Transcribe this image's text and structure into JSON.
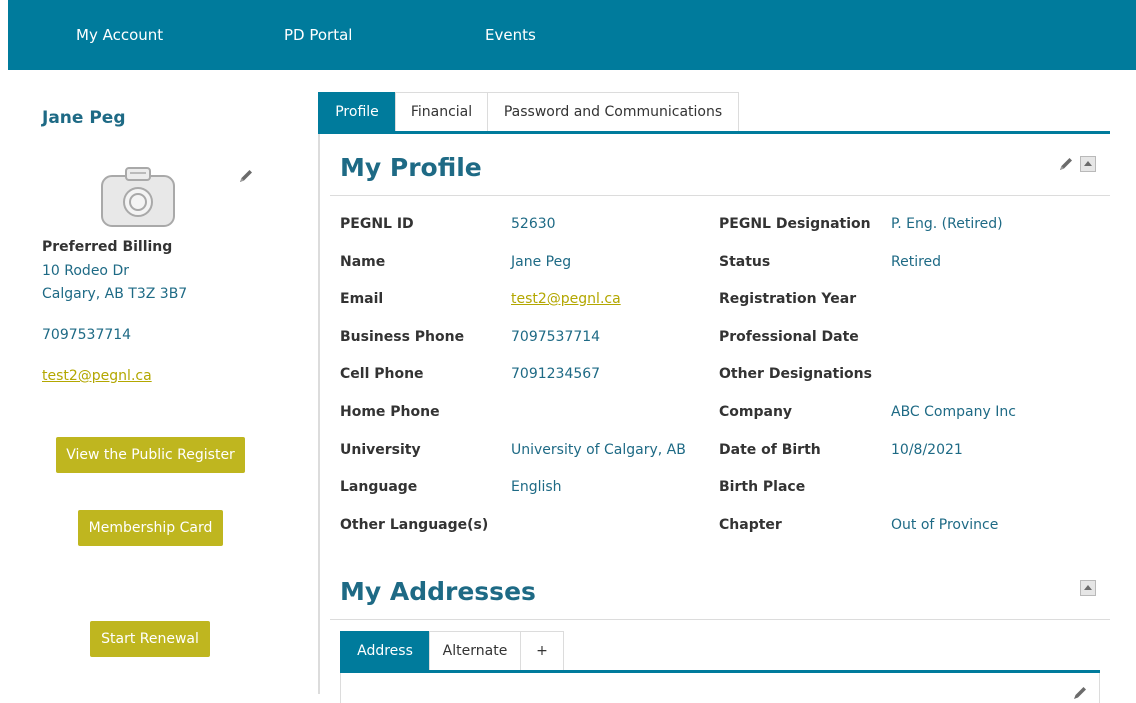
{
  "nav": {
    "items": [
      "My Account",
      "PD Portal",
      "Events"
    ]
  },
  "sidebar": {
    "name": "Jane Peg",
    "billing_title": "Preferred Billing",
    "address_line1": "10 Rodeo Dr",
    "address_line2": "Calgary, AB T3Z 3B7",
    "phone": "7097537714",
    "email": "test2@pegnl.ca",
    "buttons": {
      "public_register": "View the Public Register",
      "membership_card": "Membership Card",
      "start_renewal": "Start Renewal"
    }
  },
  "tabs": [
    "Profile",
    "Financial",
    "Password and Communications"
  ],
  "profile": {
    "title": "My Profile",
    "left_fields": [
      {
        "label": "PEGNL ID",
        "value": "52630"
      },
      {
        "label": "Name",
        "value": "Jane Peg"
      },
      {
        "label": "Email",
        "value": "test2@pegnl.ca"
      },
      {
        "label": "Business Phone",
        "value": "7097537714"
      },
      {
        "label": "Cell Phone",
        "value": "7091234567"
      },
      {
        "label": "Home Phone",
        "value": ""
      },
      {
        "label": "University",
        "value": "University of Calgary, AB"
      },
      {
        "label": "Language",
        "value": "English"
      },
      {
        "label": "Other Language(s)",
        "value": ""
      }
    ],
    "right_fields": [
      {
        "label": "PEGNL Designation",
        "value": "P. Eng. (Retired)"
      },
      {
        "label": "Status",
        "value": "Retired"
      },
      {
        "label": "Registration Year",
        "value": ""
      },
      {
        "label": "Professional Date",
        "value": ""
      },
      {
        "label": "Other Designations",
        "value": ""
      },
      {
        "label": "Company",
        "value": "ABC Company Inc"
      },
      {
        "label": "Date of Birth",
        "value": "10/8/2021"
      },
      {
        "label": "Birth Place",
        "value": ""
      },
      {
        "label": "Chapter",
        "value": "Out of Province"
      }
    ]
  },
  "addresses": {
    "title": "My Addresses",
    "tabs": [
      "Address",
      "Alternate",
      "+"
    ]
  },
  "colors": {
    "brand": "#007b9c",
    "heading": "#1e6a85",
    "accent": "#bfb61f"
  }
}
